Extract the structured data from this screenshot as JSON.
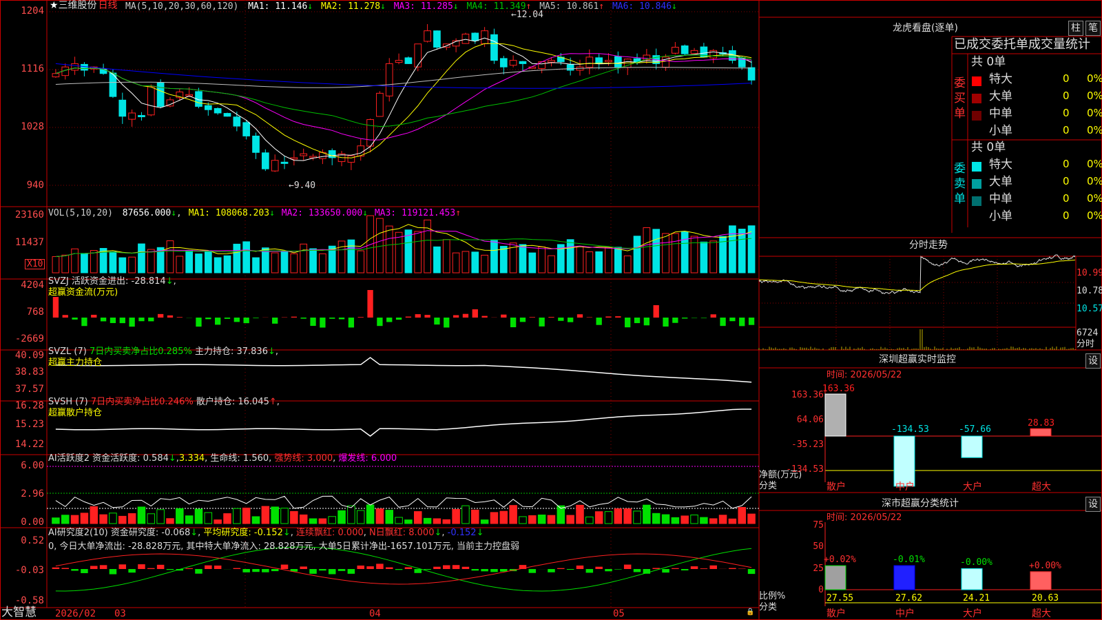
{
  "colors": {
    "up": "#ff2020",
    "down": "#00e5e5",
    "ma1": "#ffffff",
    "ma2": "#ffff00",
    "ma3": "#ff00ff",
    "ma4": "#00c000",
    "ma5": "#c0c0c0",
    "ma6": "#0000ff",
    "green": "#00e000",
    "grid": "#8b0000",
    "frame": "#cc0000"
  },
  "main": {
    "title": "三维股份",
    "period": "日线",
    "ma_prefix": "MA(5,10,20,30,60,120)",
    "ma": [
      {
        "label": "MA1: 11.146",
        "arrow": "↓"
      },
      {
        "label": "MA2: 11.278",
        "arrow": "↓"
      },
      {
        "label": "MA3: 11.285",
        "arrow": "↓"
      },
      {
        "label": "MA4: 11.349",
        "arrow": "↑"
      },
      {
        "label": "MA5: 10.861",
        "arrow": "↑"
      },
      {
        "label": "MA6: 10.846",
        "arrow": "↓"
      }
    ],
    "axis": [
      "1204",
      "1116",
      "1028",
      "940"
    ],
    "hi_note": "12.04",
    "lo_note": "9.40"
  },
  "vol": {
    "prefix": "VOL(5,10,20)",
    "value": "87656.000",
    "ma": [
      {
        "label": "MA1: 108068.203",
        "arrow": "↓"
      },
      {
        "label": "MA2: 133650.000",
        "arrow": "↓"
      },
      {
        "label": "MA3: 119121.453",
        "arrow": "↑"
      }
    ],
    "axis": [
      "23160",
      "11437"
    ],
    "unit": "X10"
  },
  "svzj": {
    "line1": "SVZJ  活跃资金进出: -28.814",
    "arrow": "↓",
    "line2": "超赢资金流(万元)",
    "axis": [
      "4204",
      "768",
      "-2669"
    ]
  },
  "svzl": {
    "prefix": "SVZL (7)",
    "ratio": "7日内买卖净占比0.285%",
    "hold": "主力持仓: 37.836",
    "arrow": "↓",
    "line2": "超赢主力持仓",
    "axis": [
      "40.09",
      "38.83",
      "37.57"
    ]
  },
  "svsh": {
    "prefix": "SVSH (7)",
    "ratio": "7日内买卖净占比0.246%",
    "hold": "散户持仓: 16.045",
    "arrow": "↑",
    "line2": "超赢散户持仓",
    "axis": [
      "16.28",
      "15.23",
      "14.22"
    ]
  },
  "ai1": {
    "prefix": "AI活跃度2",
    "a": "资金活跃度: 0.584",
    "b": "3.334",
    "c": "生命线: 1.560",
    "d": "强势线: 3.000",
    "e": "爆发线: 6.000",
    "axis": [
      "6.00",
      "2.96",
      "0.00"
    ]
  },
  "ai2": {
    "prefix": "AI研究度2(10)",
    "a": "资金研究度: -0.068",
    "b": "平均研究度: -0.152",
    "c": "连续飘红: 0.000",
    "d": "N日飘红: 8.000",
    "e": "-0.152",
    "note": "0, 今日大单净流出: -28.828万元, 其中特大单净流入: 28.828万元, 大单5日累计净出-1657.101万元, 当前主力控盘弱",
    "axis": [
      "0.52",
      "-0.03",
      "-0.58"
    ]
  },
  "bottom": {
    "brand": "大智慧",
    "dates": [
      "2026/02",
      "03",
      "04",
      "05"
    ]
  },
  "lhb": {
    "title": "龙虎看盘(逐单)",
    "tab1": "柱",
    "tab2": "笔",
    "header": "已成交委托单成交量统计",
    "buy": {
      "label": "委买单",
      "count": "共 0单",
      "rows": [
        {
          "name": "特大",
          "vol": "0",
          "pct": "0%",
          "color": "#ff0000"
        },
        {
          "name": "大单",
          "vol": "0",
          "pct": "0%",
          "color": "#a00000"
        },
        {
          "name": "中单",
          "vol": "0",
          "pct": "0%",
          "color": "#700000"
        },
        {
          "name": "小单",
          "vol": "0",
          "pct": "0%",
          "color": "#000000"
        }
      ]
    },
    "sell": {
      "label": "委卖单",
      "count": "共 0单",
      "rows": [
        {
          "name": "特大",
          "vol": "0",
          "pct": "0%",
          "color": "#00e5e5"
        },
        {
          "name": "大单",
          "vol": "0",
          "pct": "0%",
          "color": "#00a0a0"
        },
        {
          "name": "中单",
          "vol": "0",
          "pct": "0%",
          "color": "#007070"
        },
        {
          "name": "小单",
          "vol": "0",
          "pct": "0%",
          "color": "#000000"
        }
      ]
    }
  },
  "fenshi": {
    "title": "分时走势",
    "axis": [
      "10.99",
      "10.78",
      "10.57"
    ],
    "vol_val": "6724",
    "vol_lbl": "分时"
  },
  "sz1": {
    "title": "深圳超赢实时监控",
    "set": "设",
    "time": "时间: 2026/05/22",
    "axis": [
      "163.36",
      "64.06",
      "-35.23",
      "-134.53"
    ],
    "ylbl": "净额(万元)",
    "xlbl": "分类",
    "cats": [
      "散户",
      "中户",
      "大户",
      "超大"
    ],
    "values": [
      163.36,
      -134.53,
      -57.66,
      28.83
    ],
    "labels": [
      "163.36",
      "-134.53",
      "-57.66",
      "28.83"
    ]
  },
  "sz2": {
    "title": "深市超赢分类统计",
    "set": "设",
    "time": "时间: 2026/05/22",
    "axis": [
      "75",
      "50",
      "25",
      "0"
    ],
    "ylbl": "比例%",
    "xlbl": "分类",
    "cats": [
      "散户",
      "中户",
      "大户",
      "超大"
    ],
    "values": [
      27.55,
      27.62,
      24.21,
      20.63
    ],
    "changes": [
      "+0.02%",
      "-0.01%",
      "-0.00%",
      "+0.00%"
    ]
  }
}
